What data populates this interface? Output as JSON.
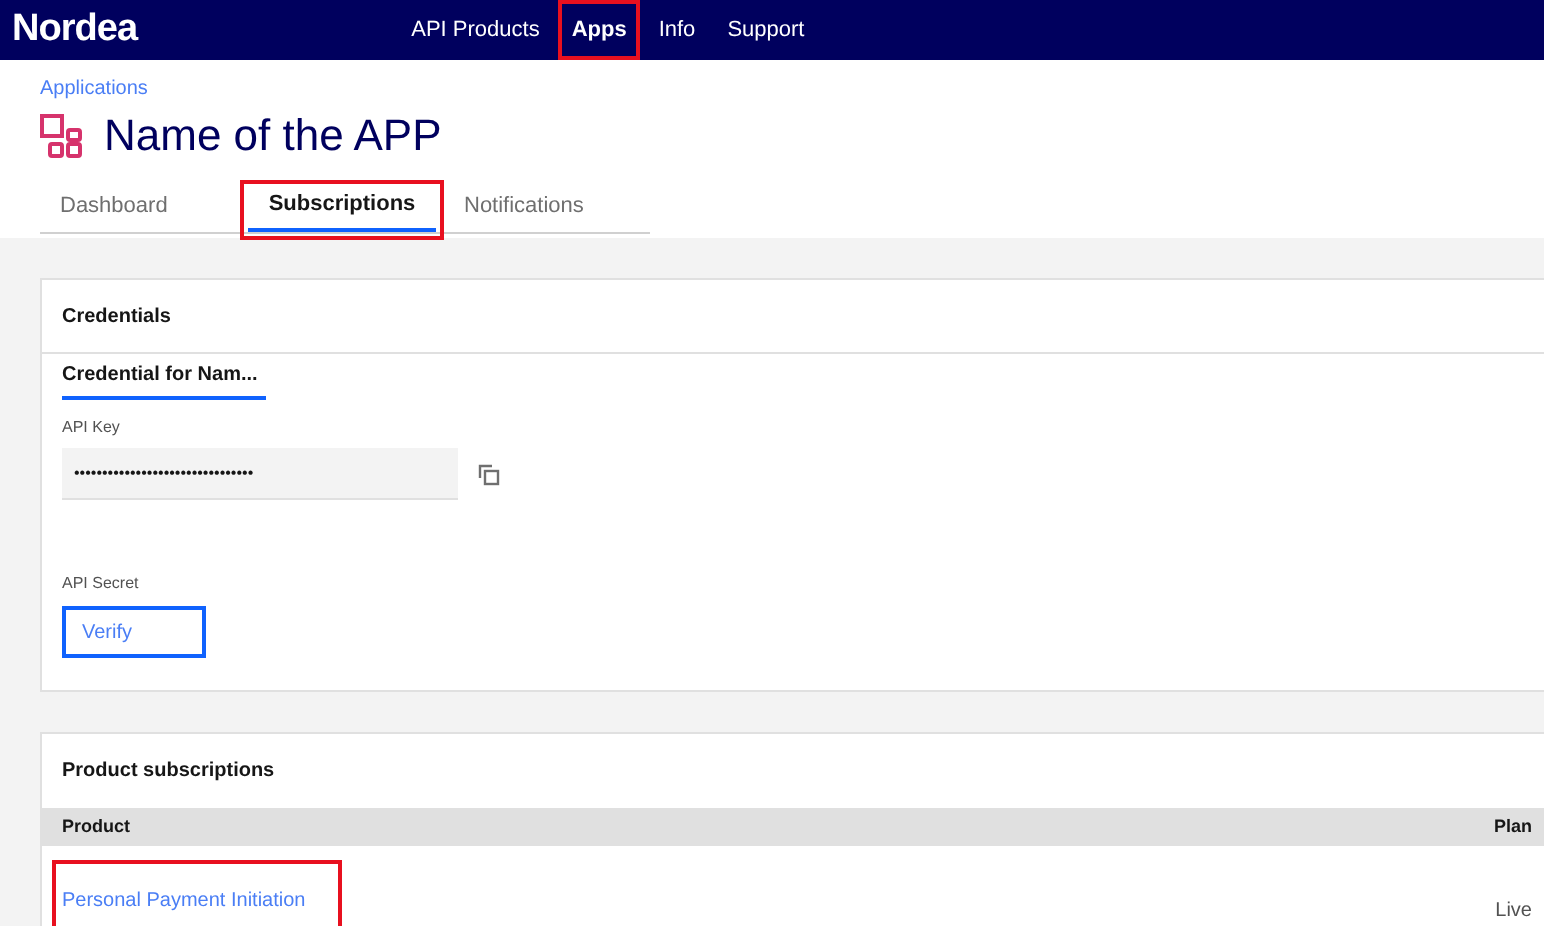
{
  "nav": {
    "logo": "Nordea",
    "items": [
      {
        "label": "API Products",
        "selected": false,
        "annotated": false
      },
      {
        "label": "Apps",
        "selected": true,
        "annotated": true
      },
      {
        "label": "Info",
        "selected": false,
        "annotated": false
      },
      {
        "label": "Support",
        "selected": false,
        "annotated": false
      }
    ]
  },
  "breadcrumb": "Applications",
  "title": "Name of the APP",
  "tabs": [
    {
      "label": "Dashboard",
      "selected": false,
      "annotated": false
    },
    {
      "label": "Subscriptions",
      "selected": true,
      "annotated": true
    },
    {
      "label": "Notifications",
      "selected": false,
      "annotated": false
    }
  ],
  "credentials": {
    "heading": "Credentials",
    "tabs": [
      {
        "label": "Credential for Nam...",
        "selected": true
      }
    ],
    "api_key": {
      "label": "API Key",
      "value": "••••••••••••••••••••••••••••••••"
    },
    "api_secret": {
      "label": "API Secret",
      "button": "Verify"
    }
  },
  "subscriptions": {
    "heading": "Product subscriptions",
    "columns": [
      "Product",
      "Plan"
    ],
    "rows": [
      {
        "product": "Personal Payment Initiation",
        "plan": "Live",
        "annotated": true
      }
    ]
  }
}
